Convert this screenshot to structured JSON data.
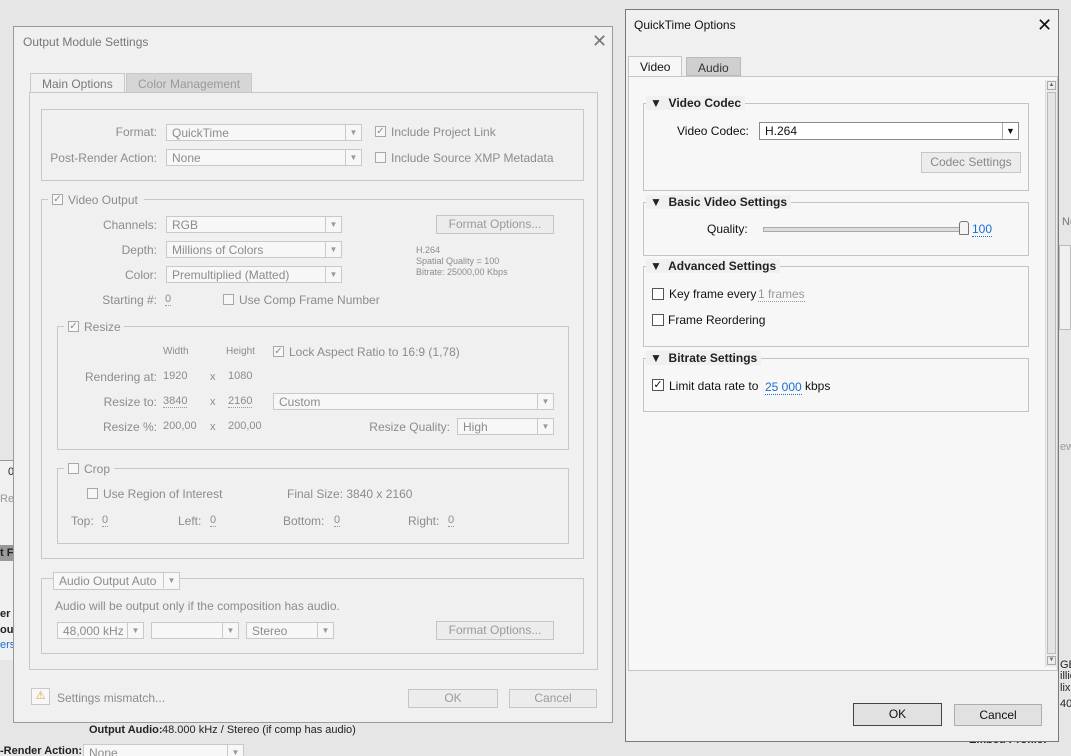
{
  "background": {
    "fragments": [
      "0",
      "Reu",
      "t F",
      "er",
      "out",
      "ers",
      "Ne",
      "ew"
    ],
    "output_audio_label": "Output Audio:",
    "output_audio_value": "48.000 kHz / Stereo (if comp has audio)",
    "post_render_label": "-Render Action:",
    "post_render_value": "None",
    "embed_profile": "Embed Profile:",
    "side_text": [
      "GB",
      "illio",
      "lix",
      "40"
    ]
  },
  "output_module": {
    "title": "Output Module Settings",
    "tabs": [
      "Main Options",
      "Color Management"
    ],
    "format_label": "Format:",
    "format_value": "QuickTime",
    "post_render_label": "Post-Render Action:",
    "post_render_value": "None",
    "include_project_link": "Include Project Link",
    "include_xmp": "Include Source XMP Metadata",
    "video_output": "Video Output",
    "channels_label": "Channels:",
    "channels_value": "RGB",
    "depth_label": "Depth:",
    "depth_value": "Millions of Colors",
    "color_label": "Color:",
    "color_value": "Premultiplied (Matted)",
    "starting_label": "Starting #:",
    "starting_value": "0",
    "use_comp_frame": "Use Comp Frame Number",
    "format_options": "Format Options...",
    "codec_info": [
      "H.264",
      "Spatial Quality = 100",
      "Bitrate: 25000,00 Kbps"
    ],
    "resize": "Resize",
    "width_label": "Width",
    "height_label": "Height",
    "lock_aspect": "Lock Aspect Ratio to 16:9 (1,78)",
    "rendering_at_label": "Rendering at:",
    "rendering_w": "1920",
    "rendering_h": "1080",
    "resize_to_label": "Resize to:",
    "resize_w": "3840",
    "resize_h": "2160",
    "resize_preset": "Custom",
    "resize_pct_label": "Resize %:",
    "resize_pct_w": "200,00",
    "resize_pct_h": "200,00",
    "x": "x",
    "resize_quality_label": "Resize Quality:",
    "resize_quality_value": "High",
    "crop": "Crop",
    "use_roi": "Use Region of Interest",
    "final_size": "Final Size: 3840 x 2160",
    "top_label": "Top:",
    "left_label": "Left:",
    "bottom_label": "Bottom:",
    "right_label": "Right:",
    "crop_value": "0",
    "audio_output": "Audio Output Auto",
    "audio_note": "Audio will be output only if the composition has audio.",
    "sample_rate": "48,000 kHz",
    "sample_depth": "",
    "channels_audio": "Stereo",
    "audio_format_options": "Format Options...",
    "warning": "Settings mismatch...",
    "ok": "OK",
    "cancel": "Cancel"
  },
  "quicktime": {
    "title": "QuickTime Options",
    "tabs": [
      "Video",
      "Audio"
    ],
    "video_codec_group": "Video Codec",
    "video_codec_label": "Video Codec:",
    "video_codec_value": "H.264",
    "codec_settings": "Codec Settings",
    "basic_group": "Basic Video Settings",
    "quality_label": "Quality:",
    "quality_value": "100",
    "quality_level": 1.0,
    "advanced_group": "Advanced Settings",
    "keyframe_label": "Key frame every",
    "keyframe_value": "1 frames",
    "frame_reordering": "Frame Reordering",
    "bitrate_group": "Bitrate Settings",
    "limit_label": "Limit data rate to",
    "limit_value": "25 000",
    "limit_unit": "kbps",
    "ok": "OK",
    "cancel": "Cancel"
  }
}
